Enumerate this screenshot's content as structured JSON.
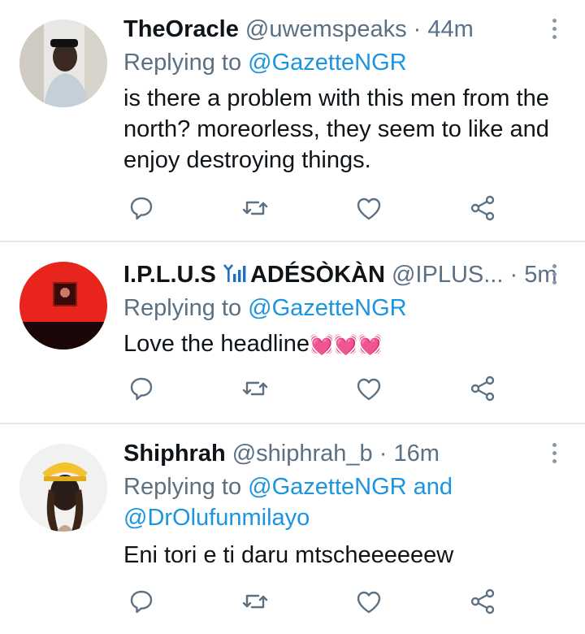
{
  "tweets": [
    {
      "display_name": "TheOracle",
      "handle": "@uwemspeaks",
      "separator": "·",
      "time": "44m",
      "replying_prefix": "Replying to",
      "mention_1": "@GazetteNGR",
      "text": "is there a problem with this men from the north? moreorless, they seem to like and enjoy destroying things.",
      "avatar_icon": "user-avatar-man-cap"
    },
    {
      "display_name_a": "I.P.L.U.S",
      "display_name_b": "ADÉSÒKÀN",
      "name_emoji": "antenna-bars-icon",
      "handle": "@IPLUS...",
      "separator": "·",
      "time": "5m",
      "replying_prefix": "Replying to",
      "mention_1": "@GazetteNGR",
      "text": "Love the headline",
      "text_emoji": "💓💓💓",
      "avatar_icon": "user-avatar-red-room"
    },
    {
      "display_name": "Shiphrah",
      "handle": "@shiphrah_b",
      "separator": "·",
      "time": "16m",
      "replying_prefix": "Replying to",
      "mention_1": "@GazetteNGR",
      "and": "and",
      "mention_2": "@DrOlufunmilayo",
      "text": "Eni tori e ti daru mtscheeeeeew",
      "avatar_icon": "user-avatar-woman-yellow-cap"
    }
  ],
  "colors": {
    "mention": "#1b95e0",
    "secondary": "#5b7083",
    "divider": "#e6e6e6"
  },
  "action_icons": [
    "reply-icon",
    "retweet-icon",
    "like-icon",
    "share-icon"
  ]
}
